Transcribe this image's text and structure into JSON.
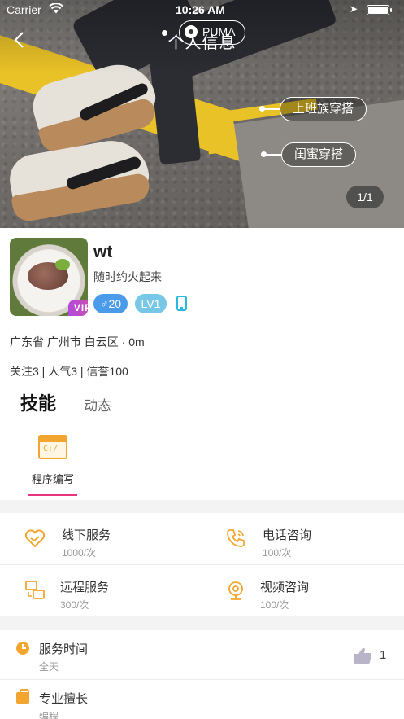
{
  "status_bar": {
    "carrier": "Carrier",
    "time": "10:26 AM"
  },
  "nav": {
    "title": "个人信息"
  },
  "hero": {
    "brand_tag": "PUMA",
    "tags": [
      "上班族穿搭",
      "闺蜜穿搭"
    ],
    "image_counter": "1/1"
  },
  "profile": {
    "username": "wt",
    "signature": "随时约火起来",
    "vip_label": "VIP",
    "gender_badge": "♂20",
    "level_badge": "LV1",
    "location": "广东省 广州市 白云区 · 0m",
    "stats": "关注3 | 人气3 | 信誉100"
  },
  "tabs": {
    "active": "技能",
    "inactive": "动态"
  },
  "skills": [
    {
      "label": "程序编写",
      "icon": "code-window-icon"
    }
  ],
  "services": [
    {
      "label": "线下服务",
      "price": "1000/次",
      "icon": "handshake-heart-icon"
    },
    {
      "label": "电话咨询",
      "price": "100/次",
      "icon": "phone-call-icon"
    },
    {
      "label": "远程服务",
      "price": "300/次",
      "icon": "remote-screens-icon"
    },
    {
      "label": "视频咨询",
      "price": "100/次",
      "icon": "webcam-icon"
    }
  ],
  "info_rows": [
    {
      "title": "服务时间",
      "value": "全天",
      "icon": "clock-icon"
    },
    {
      "title": "专业擅长",
      "value": "编程",
      "icon": "briefcase-icon"
    }
  ],
  "likes": {
    "count": "1",
    "icon": "thumbs-up-icon"
  },
  "colors": {
    "accent": "#f2a630",
    "tab_underline": "#e8337e",
    "gender_badge": "#4a9bea",
    "level_badge": "#79c7e6",
    "vip": "#c24dc2"
  }
}
